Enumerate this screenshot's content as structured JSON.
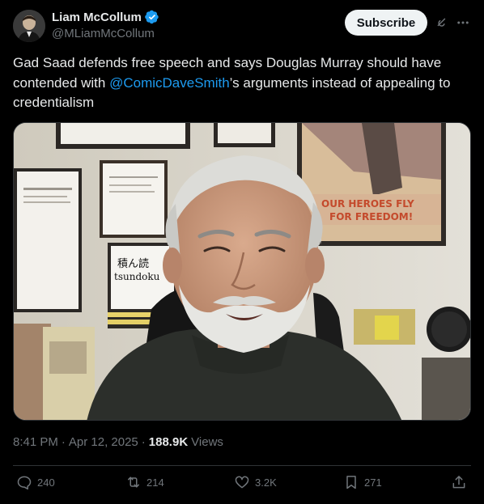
{
  "author": {
    "display_name": "Liam McCollum",
    "handle": "@MLiamMcCollum",
    "verified": true,
    "verified_color": "#1d9bf0"
  },
  "header": {
    "subscribe_label": "Subscribe",
    "grok_icon": "grok-icon",
    "more_icon": "more-icon"
  },
  "tweet": {
    "text_before": "Gad Saad defends free speech and says Douglas Murray should have contended with ",
    "mention": "@ComicDaveSmith",
    "text_after": "’s arguments instead of appealing to credentialism"
  },
  "media": {
    "poster_line1": "OUR HEROES FLY",
    "poster_line2": "FOR FREEDOM!",
    "sign_kanji": "積ん読",
    "sign_romaji": "tsundoku"
  },
  "meta": {
    "time": "8:41 PM",
    "sep1": "·",
    "date": "Apr 12, 2025",
    "sep2": "·",
    "views_count": "188.9K",
    "views_label": "Views"
  },
  "actions": {
    "replies": "240",
    "reposts": "214",
    "likes": "3.2K",
    "bookmarks": "271"
  },
  "colors": {
    "background": "#000000",
    "text": "#e7e9ea",
    "muted": "#71767b",
    "link": "#1d9bf0"
  }
}
